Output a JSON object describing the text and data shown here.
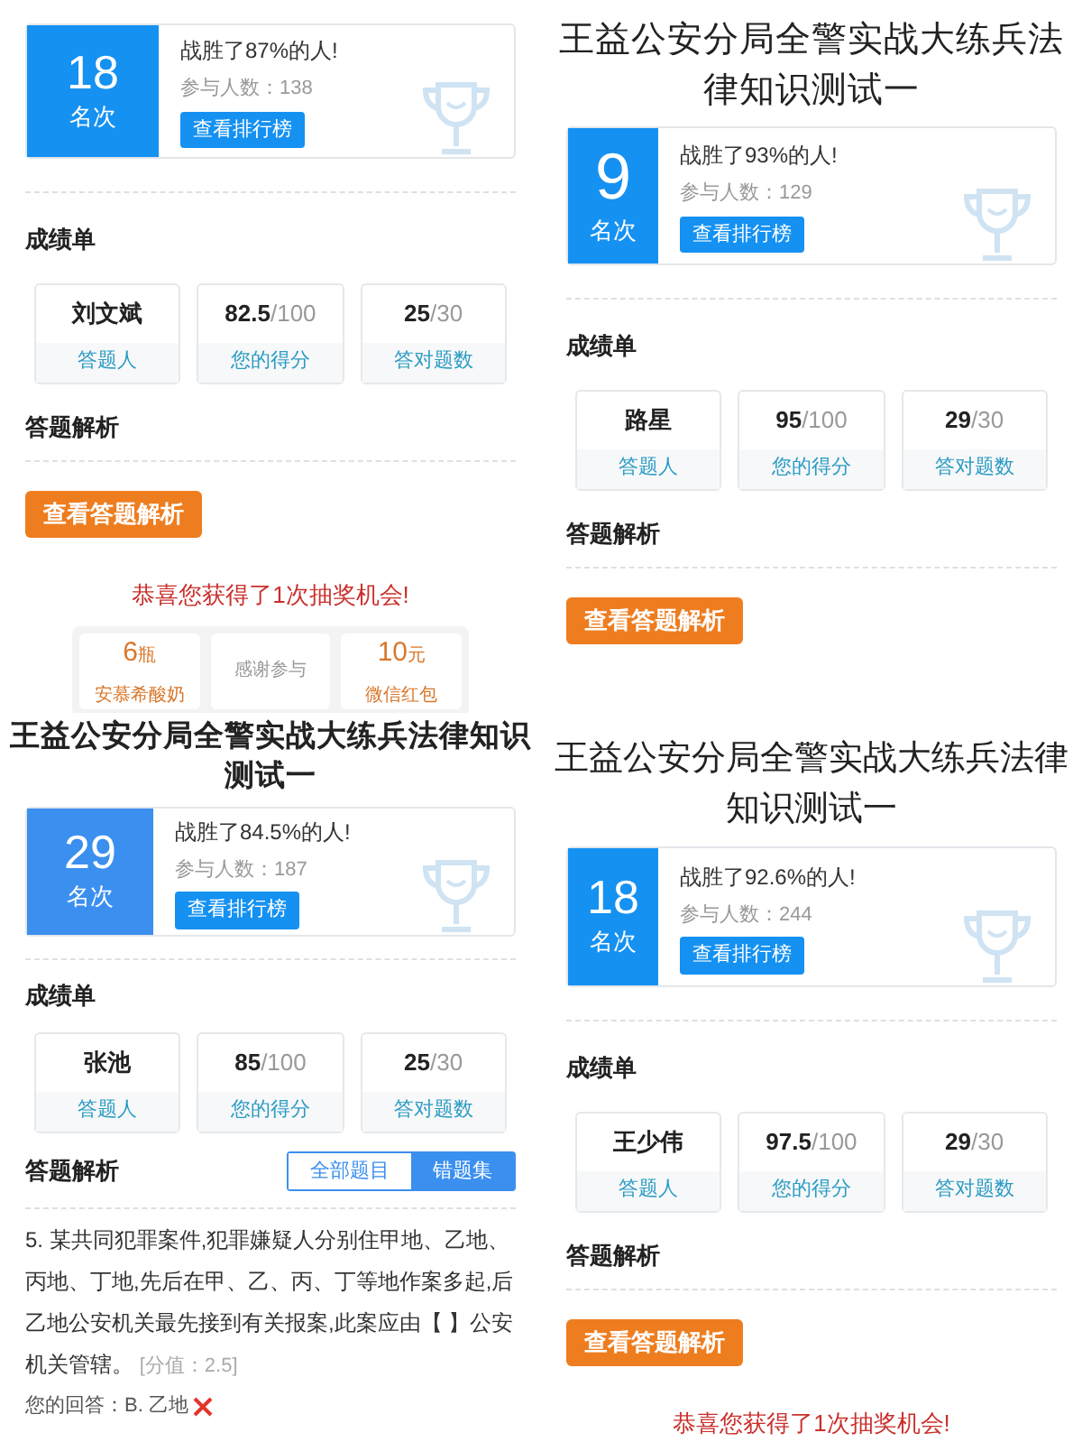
{
  "panels": [
    {
      "rank": {
        "number": "18",
        "label": "名次"
      },
      "beat_text": "战胜了87%的人!",
      "participants": "参与人数：138",
      "leaderboard_button": "查看排行榜",
      "score_heading": "成绩单",
      "cards": [
        {
          "value": "刘文斌",
          "caption": "答题人"
        },
        {
          "value": "82.5",
          "total": "/100",
          "caption": "您的得分"
        },
        {
          "value": "25",
          "total": "/30",
          "caption": "答对题数"
        }
      ],
      "analysis_heading": "答题解析",
      "analysis_button": "查看答题解析",
      "lottery_text": "恭喜您获得了1次抽奖机会!",
      "prizes": [
        {
          "amount": "6",
          "unit": "瓶",
          "name": "安慕希酸奶"
        },
        {
          "name": "感谢参与"
        },
        {
          "amount": "10",
          "unit": "元",
          "name": "微信红包"
        }
      ]
    },
    {
      "title": "王益公安分局全警实战大练兵法律知识测试一",
      "rank": {
        "number": "9",
        "label": "名次"
      },
      "beat_text": "战胜了93%的人!",
      "participants": "参与人数：129",
      "leaderboard_button": "查看排行榜",
      "score_heading": "成绩单",
      "cards": [
        {
          "value": "路星",
          "caption": "答题人"
        },
        {
          "value": "95",
          "total": "/100",
          "caption": "您的得分"
        },
        {
          "value": "29",
          "total": "/30",
          "caption": "答对题数"
        }
      ],
      "analysis_heading": "答题解析",
      "analysis_button": "查看答题解析"
    },
    {
      "title": "王益公安分局全警实战大练兵法律知识测试一",
      "rank": {
        "number": "29",
        "label": "名次"
      },
      "beat_text": "战胜了84.5%的人!",
      "participants": "参与人数：187",
      "leaderboard_button": "查看排行榜",
      "score_heading": "成绩单",
      "cards": [
        {
          "value": "张池",
          "caption": "答题人"
        },
        {
          "value": "85",
          "total": "/100",
          "caption": "您的得分"
        },
        {
          "value": "25",
          "total": "/30",
          "caption": "答对题数"
        }
      ],
      "analysis_heading": "答题解析",
      "tabs": [
        {
          "label": "全部题目",
          "selected": false
        },
        {
          "label": "错题集",
          "selected": true
        }
      ],
      "question": {
        "text": "5. 某共同犯罪案件,犯罪嫌疑人分别住甲地、乙地、丙地、丁地,先后在甲、乙、丙、丁等地作案多起,后乙地公安机关最先接到有关报案,此案应由【 】公安机关管辖。",
        "points": "[分值：2.5]",
        "answer": "您的回答：B. 乙地",
        "correct": false
      }
    },
    {
      "title": "王益公安分局全警实战大练兵法律知识测试一",
      "rank": {
        "number": "18",
        "label": "名次"
      },
      "beat_text": "战胜了92.6%的人!",
      "participants": "参与人数：244",
      "leaderboard_button": "查看排行榜",
      "score_heading": "成绩单",
      "cards": [
        {
          "value": "王少伟",
          "caption": "答题人"
        },
        {
          "value": "97.5",
          "total": "/100",
          "caption": "您的得分"
        },
        {
          "value": "29",
          "total": "/30",
          "caption": "答对题数"
        }
      ],
      "analysis_heading": "答题解析",
      "analysis_button": "查看答题解析",
      "lottery_text": "恭喜您获得了1次抽奖机会!"
    }
  ]
}
